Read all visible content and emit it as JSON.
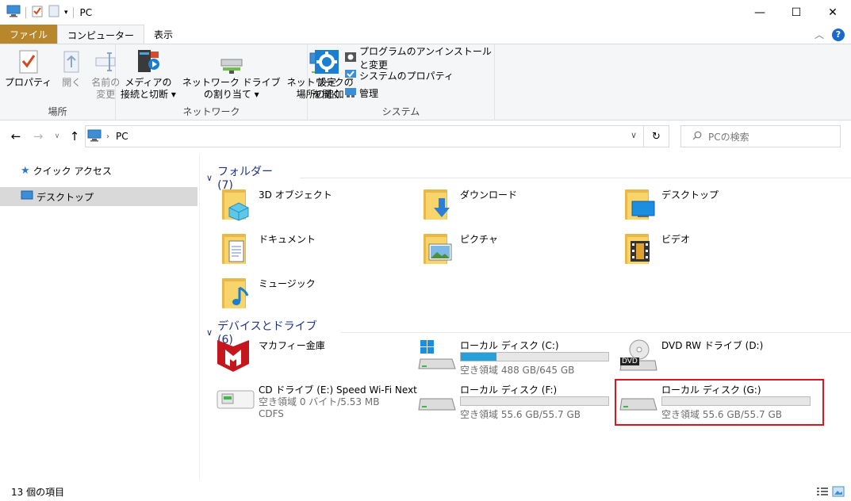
{
  "window": {
    "title": "PC",
    "minimize_glyph": "—",
    "maximize_glyph": "☐",
    "close_glyph": "✕"
  },
  "ribbon_tabs": [
    {
      "label": "ファイル"
    },
    {
      "label": "コンピューター"
    },
    {
      "label": "表示"
    }
  ],
  "ribbon": {
    "location_group": {
      "label": "場所",
      "buttons": [
        {
          "label": "プロパティ"
        },
        {
          "label": "開く"
        },
        {
          "label": "名前の\n変更"
        }
      ]
    },
    "network_group": {
      "label": "ネットワーク",
      "buttons": [
        {
          "label": "メディアの\n接続と切断 ▾"
        },
        {
          "label": "ネットワーク ドライブ\nの割り当て ▾"
        },
        {
          "label": "ネットワークの\n場所の追加"
        }
      ]
    },
    "system_group": {
      "label": "システム",
      "settings_label": "設定\nを開く",
      "small_buttons": [
        {
          "label": "プログラムのアンインストールと変更"
        },
        {
          "label": "システムのプロパティ"
        },
        {
          "label": "管理"
        }
      ]
    }
  },
  "address": {
    "path": "PC",
    "search_placeholder": "PCの検索"
  },
  "nav": {
    "items": [
      {
        "label": "クイック アクセス"
      },
      {
        "label": "デスクトップ"
      }
    ]
  },
  "folders": {
    "header": "フォルダー (7)",
    "items": [
      {
        "label": "3D オブジェクト"
      },
      {
        "label": "ダウンロード"
      },
      {
        "label": "デスクトップ"
      },
      {
        "label": "ドキュメント"
      },
      {
        "label": "ピクチャ"
      },
      {
        "label": "ビデオ"
      },
      {
        "label": "ミュージック"
      }
    ]
  },
  "devices": {
    "header": "デバイスとドライブ (6)",
    "items": [
      {
        "name": "マカフィー金庫"
      },
      {
        "name": "ローカル ディスク (C:)",
        "free": "空き領域 488 GB/645 GB",
        "used_fraction": 0.24
      },
      {
        "name": "DVD RW ドライブ (D:)"
      },
      {
        "name": "CD ドライブ (E:) Speed Wi-Fi Next",
        "free": "空き領域 0 バイト/5.53 MB",
        "fs": "CDFS"
      },
      {
        "name": "ローカル ディスク (F:)",
        "free": "空き領域 55.6 GB/55.7 GB",
        "used_fraction": 0.0
      },
      {
        "name": "ローカル ディスク (G:)",
        "free": "空き領域 55.6 GB/55.7 GB",
        "used_fraction": 0.0
      }
    ],
    "dvd_badge": "DVD"
  },
  "status": {
    "count": "13 個の項目"
  }
}
